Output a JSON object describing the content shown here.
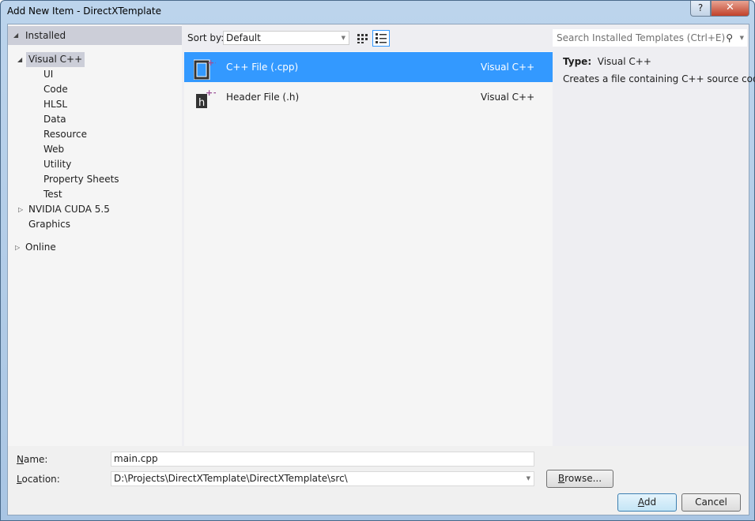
{
  "window": {
    "title": "Add New Item - DirectXTemplate",
    "help": "?",
    "close": "✕"
  },
  "tree": {
    "installed": "Installed",
    "visual_cpp": "Visual C++",
    "children": [
      "UI",
      "Code",
      "HLSL",
      "Data",
      "Resource",
      "Web",
      "Utility",
      "Property Sheets",
      "Test"
    ],
    "cuda": "NVIDIA CUDA 5.5",
    "graphics": "Graphics",
    "online": "Online"
  },
  "toolbar": {
    "sort_label": "Sort by:",
    "sort_value": "Default",
    "search_placeholder": "Search Installed Templates (Ctrl+E)"
  },
  "templates": [
    {
      "name": "C++ File (.cpp)",
      "type": "Visual C++",
      "selected": true
    },
    {
      "name": "Header File (.h)",
      "type": "Visual C++",
      "selected": false
    }
  ],
  "details": {
    "type_label": "Type:",
    "type_value": "Visual C++",
    "description": "Creates a file containing C++ source code"
  },
  "form": {
    "name_label_u": "N",
    "name_label_rest": "ame:",
    "name_value": "main.cpp",
    "location_label_u": "L",
    "location_label_rest": "ocation:",
    "location_value": "D:\\Projects\\DirectXTemplate\\DirectXTemplate\\src\\",
    "browse_u": "B",
    "browse_rest": "rowse...",
    "add_u": "A",
    "add_rest": "dd",
    "cancel": "Cancel"
  },
  "colors": {
    "selection": "#3399ff",
    "accent_icon": "#9b4f96"
  }
}
